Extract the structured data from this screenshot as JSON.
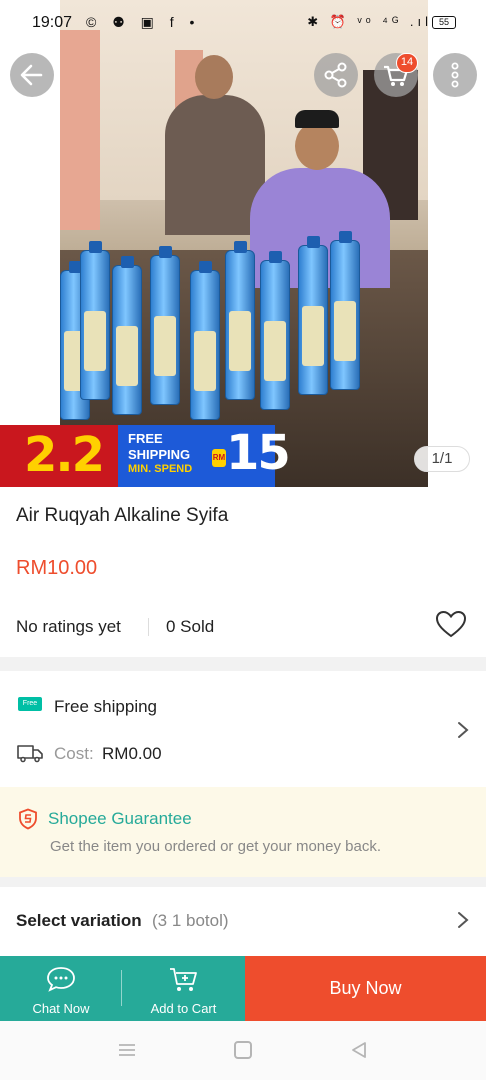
{
  "status_bar": {
    "time": "19:07",
    "left_icons": "© ⚉ ▣ f •",
    "right_icons": "✱ ⏰ ᵛᵒ ⁴ᴳ .ıl",
    "battery": "55"
  },
  "header": {
    "cart_badge": "14"
  },
  "promo": {
    "left_number": "2.2",
    "free": "FREE",
    "shipping": "SHIPPING",
    "min_spend": "MIN. SPEND",
    "currency_tag": "RM",
    "amount": "15"
  },
  "gallery": {
    "counter": "1/1"
  },
  "product": {
    "title": "Air Ruqyah Alkaline Syifa",
    "price": "RM10.00",
    "ratings": "No ratings yet",
    "sold": "0 Sold"
  },
  "shipping": {
    "free_icon_text": "Free",
    "free_label": "Free shipping",
    "cost_label": "Cost:",
    "cost_value": "RM0.00"
  },
  "guarantee": {
    "title": "Shopee Guarantee",
    "subtitle": "Get the item you ordered or get your money back."
  },
  "variation": {
    "label": "Select variation",
    "value": "(3 1 botol)"
  },
  "actions": {
    "chat": "Chat Now",
    "add_to_cart": "Add to Cart",
    "buy_now": "Buy Now"
  },
  "colors": {
    "brand_orange": "#ee4d2d",
    "teal": "#26aa99",
    "guarantee_bg": "#fdf9e8"
  }
}
